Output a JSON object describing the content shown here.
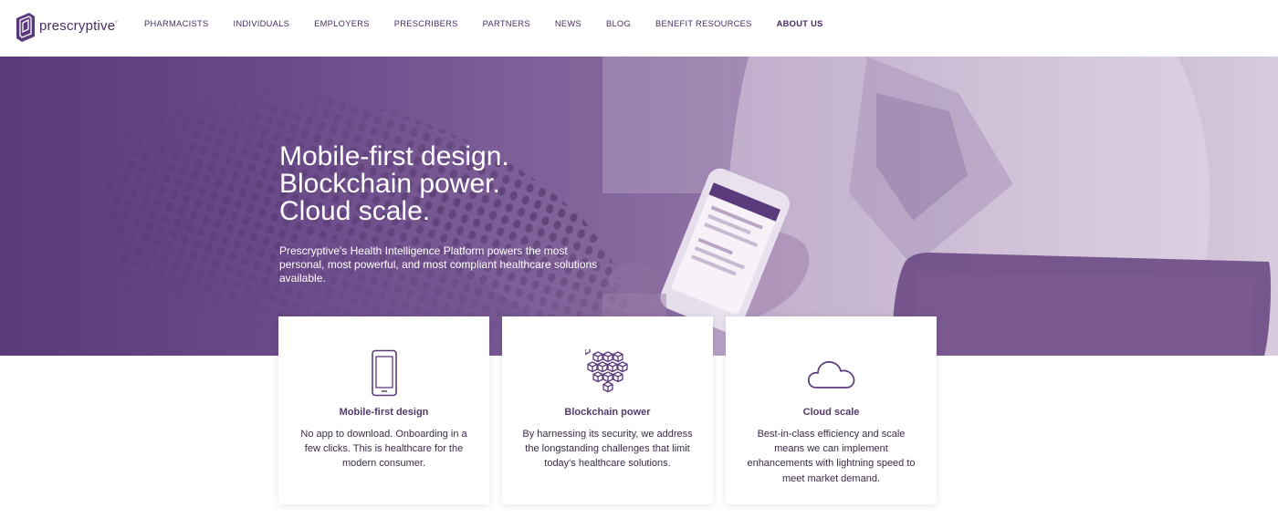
{
  "brand": {
    "name": "prescryptive",
    "trademark": "°"
  },
  "nav": [
    {
      "label": "PHARMACISTS",
      "active": false
    },
    {
      "label": "INDIVIDUALS",
      "active": false
    },
    {
      "label": "EMPLOYERS",
      "active": false
    },
    {
      "label": "PRESCRIBERS",
      "active": false
    },
    {
      "label": "PARTNERS",
      "active": false
    },
    {
      "label": "NEWS",
      "active": false
    },
    {
      "label": "BLOG",
      "active": false
    },
    {
      "label": "BENEFIT RESOURCES",
      "active": false
    },
    {
      "label": "ABOUT US",
      "active": true
    }
  ],
  "hero": {
    "title_lines": [
      "Mobile-first design.",
      "Blockchain power.",
      "Cloud scale."
    ],
    "subtitle": "Prescryptive's Health Intelligence Platform powers the most personal, most powerful, and most compliant healthcare solutions available."
  },
  "cards": [
    {
      "icon": "phone-icon",
      "title": "Mobile-first design",
      "text": "No app to download. Onboarding in a few clicks. This is healthcare for the modern consumer."
    },
    {
      "icon": "blockchain-icon",
      "title": "Blockchain power",
      "text": "By harnessing its security, we address the longstanding challenges that limit today's healthcare solutions."
    },
    {
      "icon": "cloud-icon",
      "title": "Cloud scale",
      "text": "Best-in-class efficiency and scale means we can implement enhancements with lightning speed to meet market demand."
    }
  ],
  "colors": {
    "brand_purple": "#4a2b63",
    "hero_purple": "#5b3a7c",
    "card_title": "#553a6e"
  }
}
